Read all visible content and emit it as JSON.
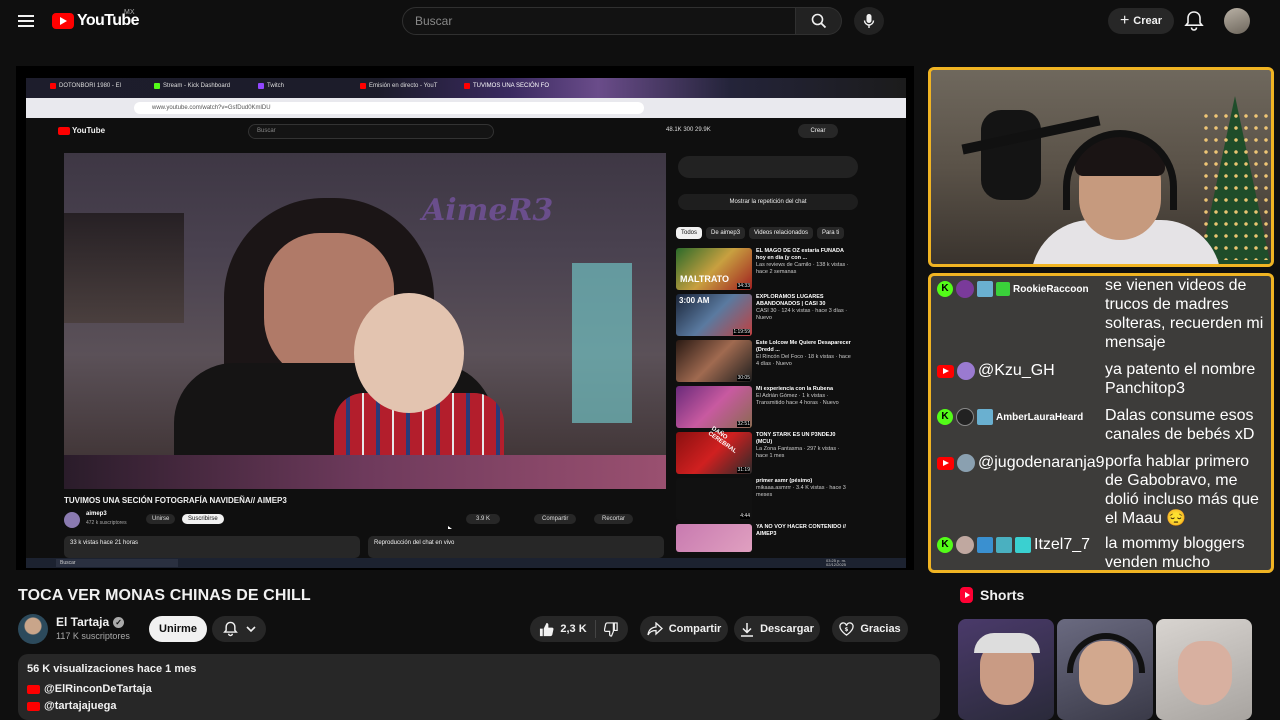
{
  "header": {
    "logo_text": "YouTube",
    "region": "MX",
    "search_placeholder": "Buscar",
    "create_label": "Crear"
  },
  "embedded_stream": {
    "browser_tabs": [
      "DOTONBORI 1980 - El",
      "Stream - Kick Dashboard",
      "Twitch",
      "Emisión en directo - YouT",
      "TUVIMOS UNA SECIÓN FO"
    ],
    "address": "www.youtube.com/watch?v=GsfDud0KmlDU",
    "inner_logo": "YouTube",
    "inner_search": "Buscar",
    "inner_stats": "48.1K   300   29.9K",
    "inner_create": "Crear",
    "video_watermark": "AimeR3",
    "video_title": "TUVIMOS UNA SECIÓN FOTOGRAFÍA NAVIDEÑA// AIMEP3",
    "channel": "aimep3",
    "channel_subs": "472 k suscriptores",
    "join": "Unirse",
    "subscribe": "Suscribirse",
    "likes": "3.9 K",
    "share": "Compartir",
    "clip": "Recortar",
    "views_line": "33 k vistas  hace 21 horas",
    "chat_replay_bottom": "Reproducción del chat en vivo",
    "chat_replay_button": "Mostrar la repetición del chat",
    "filters": [
      "Todos",
      "De aimep3",
      "Videos relacionados",
      "Para ti"
    ],
    "related": [
      {
        "title": "EL MAGO DE OZ estaría FUNADA hoy en día (y con ...",
        "meta": "Las reviews de Camilo · 138 k vistas · hace 2 semanas",
        "dur": "34:33",
        "thumb_label": "MALTRATO"
      },
      {
        "title": "EXPLORAMOS LUGARES ABANDONADOS | CASI 30",
        "meta": "CASI 30 · 124 k vistas · hace 3 días · Nuevo",
        "dur": "1:19:59",
        "thumb_label": "3:00 AM"
      },
      {
        "title": "Este Lolcow Me Quiere Desaparecer (Dredd ...",
        "meta": "El Rincón Del Foco · 18 k vistas · hace 4 días · Nuevo",
        "dur": "30:05",
        "thumb_label": ""
      },
      {
        "title": "Mi experiencia con la Rubena",
        "meta": "El Adrián Gómez · 1 k vistas · Transmitido hace 4 horas · Nuevo",
        "dur": "32:51",
        "thumb_label": ""
      },
      {
        "title": "TONY STARK ES UN P3NDEJ0 (MCU)",
        "meta": "La Zona Fantasma · 297 k vistas · hace 1 mes",
        "dur": "31:19",
        "thumb_label": "DAÑO CEREBRAL"
      },
      {
        "title": "primer asmr (pésimo)",
        "meta": "mikaaa.asmrrr · 3.4 K vistas · hace 3 meses",
        "dur": "4:44",
        "thumb_label": ""
      },
      {
        "title": "YA NO VOY HACER CONTENIDO // AIMEP3",
        "meta": "",
        "dur": "",
        "thumb_label": ""
      }
    ],
    "taskbar_search": "Buscar",
    "clock": "03:25 p. m.\n02/12/2025"
  },
  "chat_overlay": {
    "messages": [
      {
        "platform": "kick",
        "user": "RookieRaccoon",
        "text": "se vienen videos de trucos de madres solteras, recuerden mi mensaje"
      },
      {
        "platform": "youtube",
        "user": "@Kzu_GH",
        "text": "ya patento el nombre Panchitop3"
      },
      {
        "platform": "kick",
        "user": "AmberLauraHeard",
        "text": "Dalas consume esos canales de bebés xD"
      },
      {
        "platform": "youtube",
        "user": "@jugodenaranja9",
        "text": "porfa hablar primero de Gabobravo, me dolió incluso más que el Maau 😔"
      },
      {
        "platform": "kick",
        "user": "Itzel7_7",
        "text": "la mommy bloggers venden mucho también"
      }
    ]
  },
  "video": {
    "title": "TOCA VER MONAS CHINAS DE CHILL",
    "channel_name": "El Tartaja",
    "subscribers": "117 K suscriptores",
    "join_label": "Unirme",
    "likes": "2,3 K",
    "share_label": "Compartir",
    "download_label": "Descargar",
    "thanks_label": "Gracias"
  },
  "description": {
    "meta": "56 K visualizaciones  hace 1 mes",
    "links": [
      "@ElRinconDeTartaja",
      "@tartajajuega"
    ]
  },
  "shorts": {
    "heading": "Shorts"
  },
  "colors": {
    "accent_border": "#f0b423",
    "youtube_red": "#ff0000",
    "kick_green": "#53fc18"
  }
}
